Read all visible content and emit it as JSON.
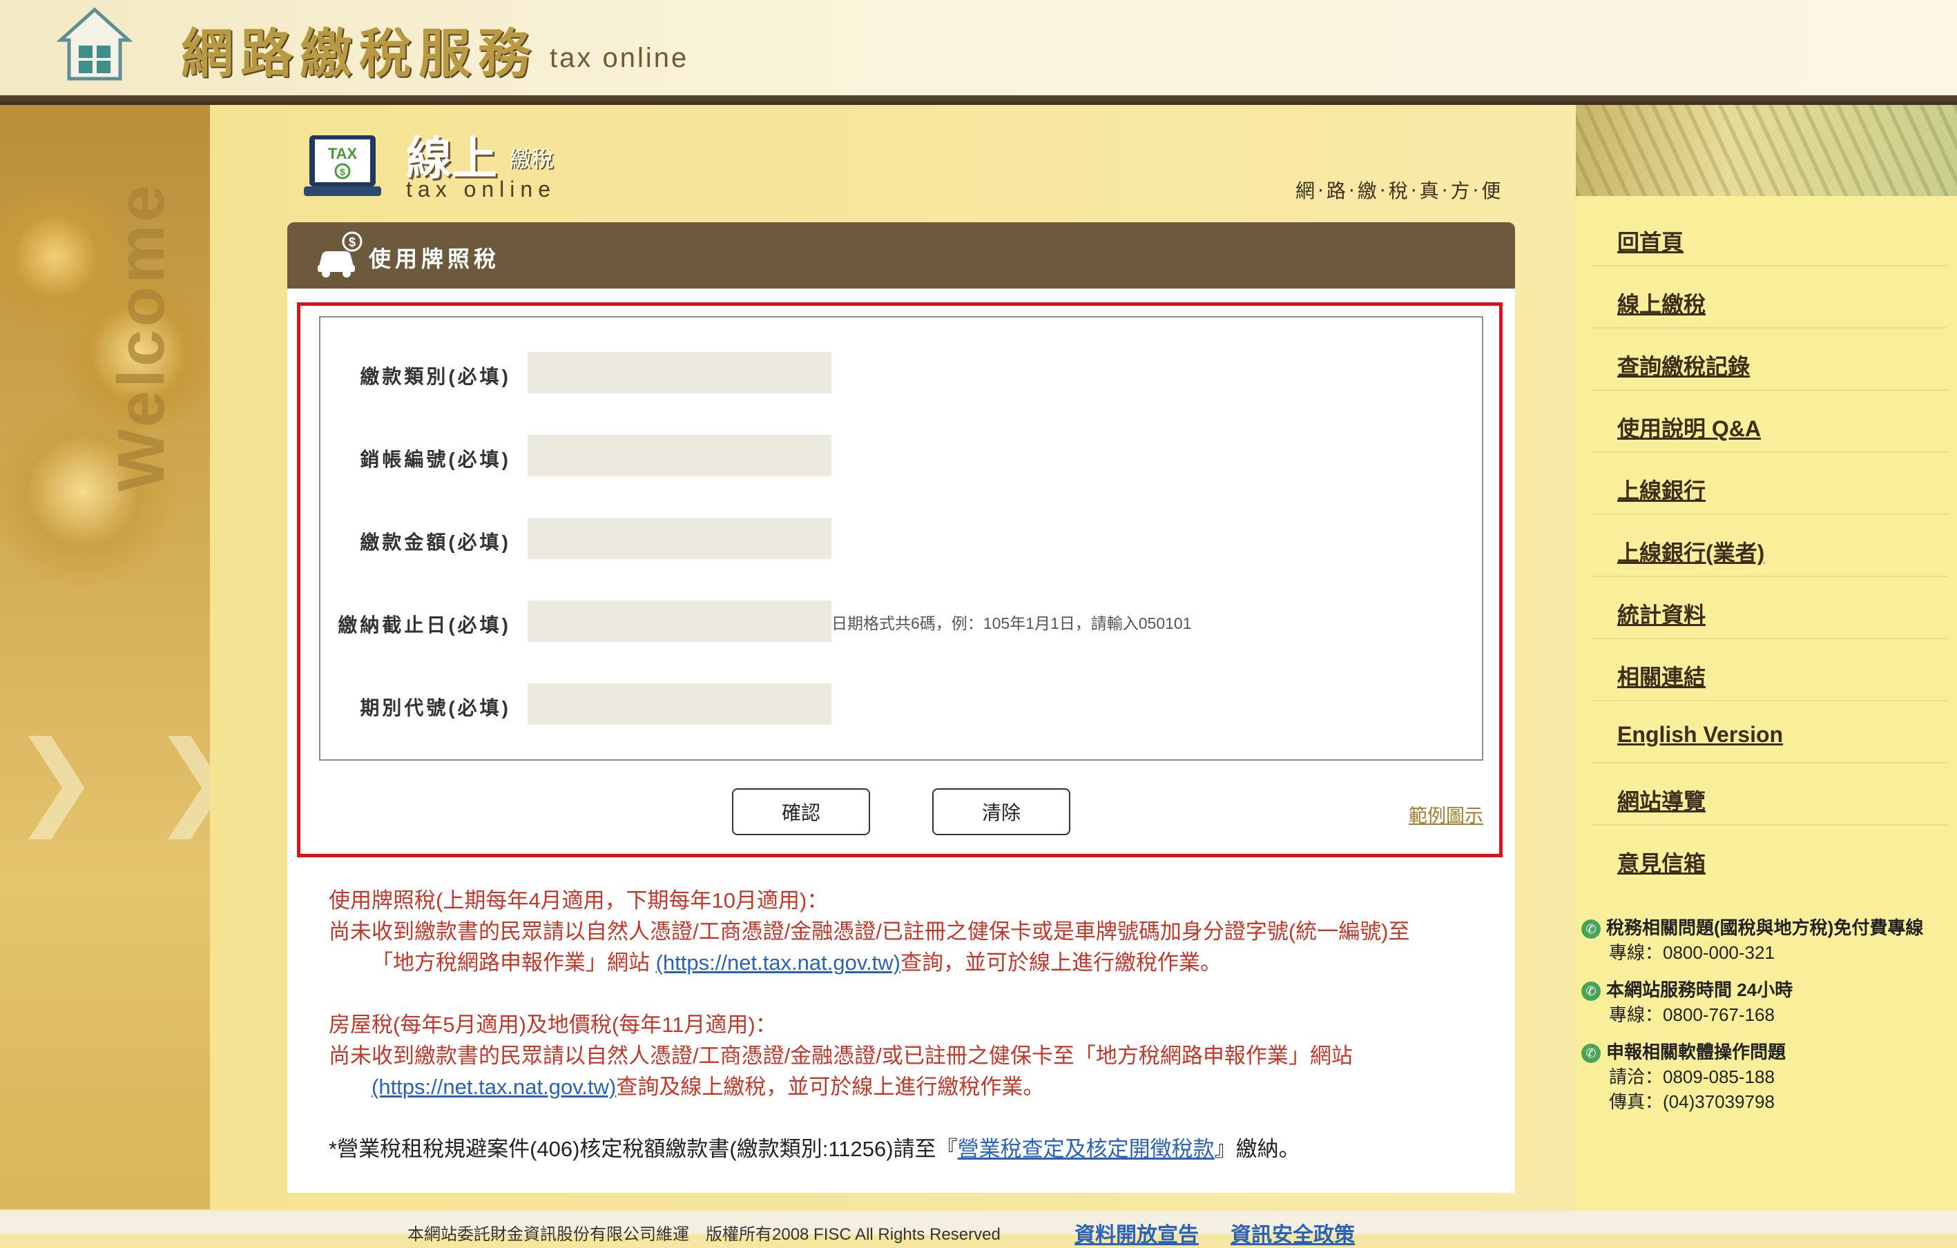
{
  "header": {
    "brand_zh": "網路繳稅服務",
    "brand_en": "tax online"
  },
  "left_decoration": {
    "welcome": "Welcome",
    "arrow_glyph": "❯"
  },
  "section": {
    "title": "線上",
    "title_small": "繳稅",
    "subtitle": "tax online",
    "icon_text": "TAX",
    "slogan": "網‧路‧繳‧稅‧真‧方‧便"
  },
  "panel": {
    "title": "使用牌照稅",
    "fields": [
      {
        "label": "繳款類別(必填)",
        "value": ""
      },
      {
        "label": "銷帳編號(必填)",
        "value": ""
      },
      {
        "label": "繳款金額(必填)",
        "value": ""
      },
      {
        "label": "繳納截止日(必填)",
        "value": "",
        "hint": "日期格式共6碼，例：105年1月1日，請輸入050101"
      },
      {
        "label": "期別代號(必填)",
        "value": ""
      }
    ],
    "confirm_label": "確認",
    "clear_label": "清除",
    "example_link": "範例圖示"
  },
  "notes": {
    "p1_title": "使用牌照稅(上期每年4月適用，下期每年10月適用)：",
    "p1_line1": "尚未收到繳款書的民眾請以自然人憑證/工商憑證/金融憑證/已註冊之健保卡或是車牌號碼加身分證字號(統一編號)至",
    "p1_line2_pre": "「地方稅網路申報作業」網站 ",
    "p1_link": "(https://net.tax.nat.gov.tw)",
    "p1_line2_post": "查詢，並可於線上進行繳稅作業。",
    "p2_title": "房屋稅(每年5月適用)及地價稅(每年11月適用)：",
    "p2_line1": "尚未收到繳款書的民眾請以自然人憑證/工商憑證/金融憑證/或已註冊之健保卡至「地方稅網路申報作業」網站",
    "p2_link": "(https://net.tax.nat.gov.tw)",
    "p2_line2_post": "查詢及線上繳稅，並可於線上進行繳稅作業。",
    "p3_pre": "*營業稅租稅規避案件(406)核定稅額繳款書(繳款類別:11256)請至『",
    "p3_link": "營業稅查定及核定開徵稅款",
    "p3_post": "』繳納。"
  },
  "sidebar": {
    "nav": [
      "回首頁",
      "線上繳稅",
      "查詢繳稅記錄",
      "使用說明 Q&A",
      "上線銀行",
      "上線銀行(業者)",
      "統計資料",
      "相關連結",
      "English Version",
      "網站導覽",
      "意見信箱"
    ],
    "contacts": [
      {
        "title": "稅務相關問題(國稅與地方稅)免付費專線",
        "lines": [
          "專線：0800-000-321"
        ]
      },
      {
        "title": "本網站服務時間 24小時",
        "lines": [
          "專線：0800-767-168"
        ]
      },
      {
        "title": "申報相關軟體操作問題",
        "lines": [
          "請洽：0809-085-188",
          "傳真：(04)37039798"
        ]
      }
    ]
  },
  "footer": {
    "text": "本網站委託財金資訊股份有限公司維運　版權所有2008 FISC All Rights Reserved",
    "link1": "資料開放宣告",
    "link2": "資訊安全政策"
  },
  "colors": {
    "accent_brown": "#6d5a3d",
    "frame_red": "#e0101a",
    "note_red": "#c0392b",
    "link_blue": "#2b62b6",
    "sidebar_yellow": "#f9ef9a"
  }
}
